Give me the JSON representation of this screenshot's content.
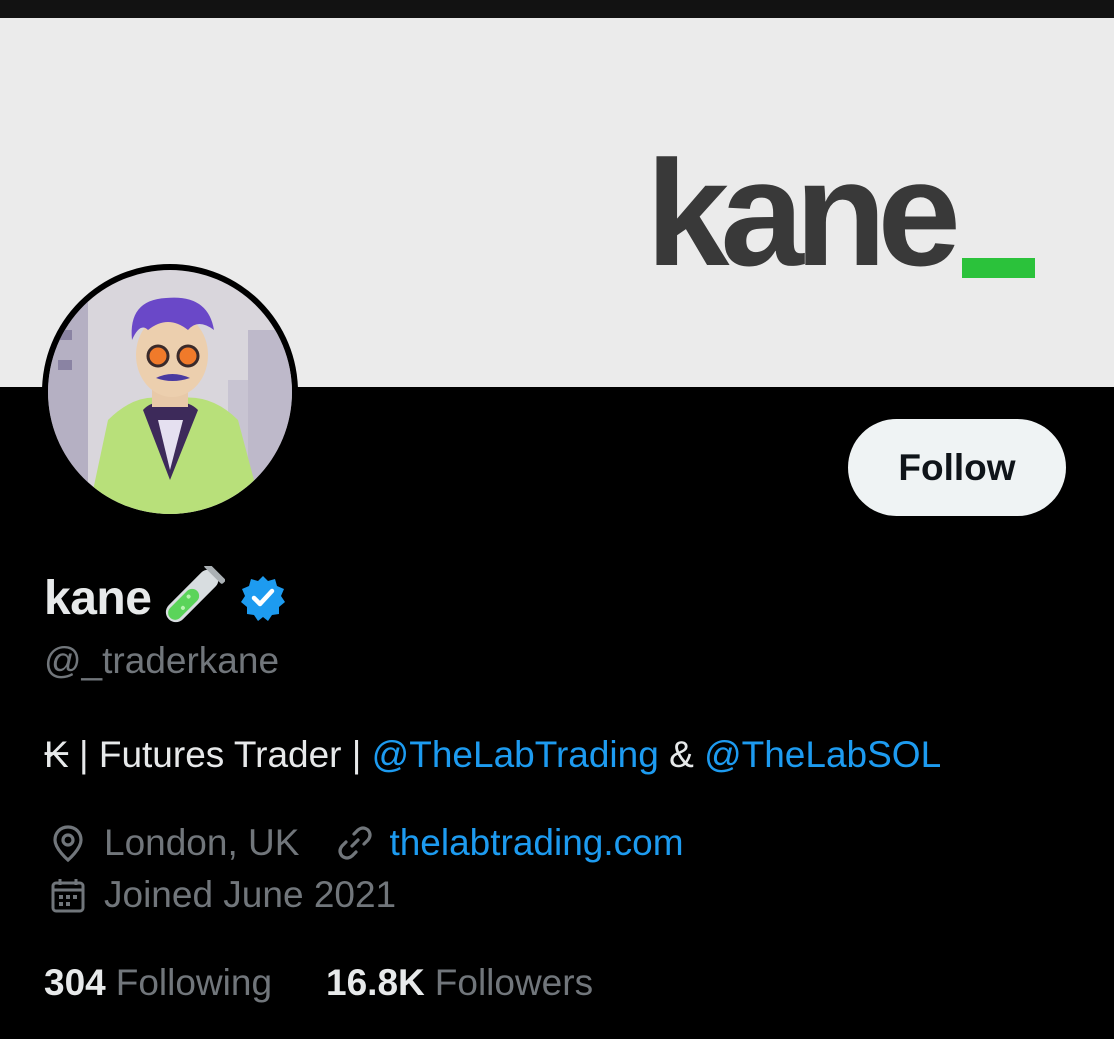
{
  "banner": {
    "wordmark": "kane",
    "accent_color": "#2bc23b"
  },
  "profile": {
    "display_name": "kane",
    "name_emoji_icon": "test-tube-icon",
    "verified_icon": "verified-badge-icon",
    "handle": "@_traderkane",
    "follow_label": "Follow"
  },
  "bio": {
    "prefix": "₭ | Futures Trader | ",
    "mention1": "@TheLabTrading",
    "joiner": " & ",
    "mention2": "@TheLabSOL"
  },
  "meta": {
    "location": "London, UK",
    "location_icon": "location-pin-icon",
    "website": "thelabtrading.com",
    "website_icon": "link-icon",
    "joined": "Joined June 2021",
    "joined_icon": "calendar-icon"
  },
  "stats": {
    "following_count": "304",
    "following_label": "Following",
    "followers_count": "16.8K",
    "followers_label": "Followers"
  },
  "colors": {
    "accent": "#1d9bf0",
    "secondary_text": "#71767b",
    "primary_text": "#e7e9ea"
  }
}
